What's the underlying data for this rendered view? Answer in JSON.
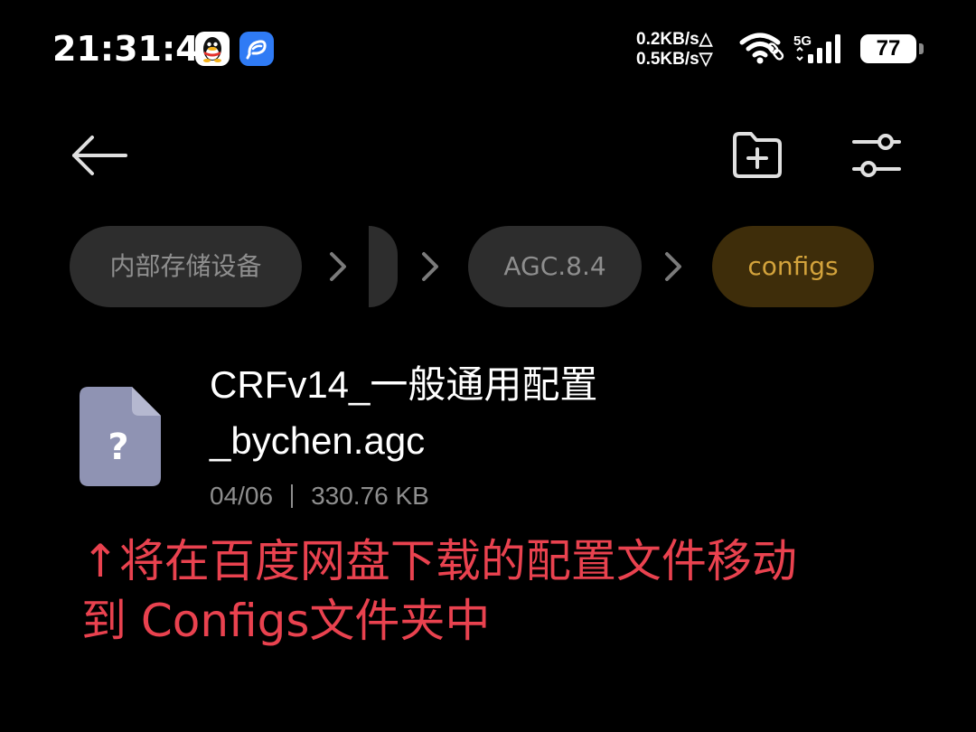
{
  "status_bar": {
    "time": "21:31:47",
    "apps": [
      {
        "name": "qq-icon"
      },
      {
        "name": "feather-icon"
      }
    ],
    "upload_speed": "0.2KB/s△",
    "download_speed": "0.5KB/s▽",
    "network_type": "5G",
    "battery_level": "77"
  },
  "toolbar": {
    "back_icon": "arrow-left-icon",
    "new_folder_icon": "folder-plus-icon",
    "filter_icon": "sliders-icon"
  },
  "breadcrumb": {
    "items": [
      {
        "label": "内部存储设备"
      },
      {
        "label": ""
      },
      {
        "label": "AGC.8.4"
      },
      {
        "label": "configs",
        "active": true
      }
    ]
  },
  "file": {
    "name_line1": "CRFv14_一般通用配置",
    "name_line2": "_bychen.agc",
    "date": "04/06",
    "size": "330.76 KB",
    "icon": "unknown-file-icon"
  },
  "annotation": {
    "line1": "↑将在百度网盘下载的配置文件移动",
    "line2": "到 Configs文件夹中"
  },
  "colors": {
    "background": "#000000",
    "chip": "#2d2d2d",
    "chip_active": "#3e2d0a",
    "chip_active_text": "#d3a33c",
    "muted_text": "#8e8e8e",
    "file_icon": "#8f93b3",
    "annotation": "#e9424f"
  }
}
